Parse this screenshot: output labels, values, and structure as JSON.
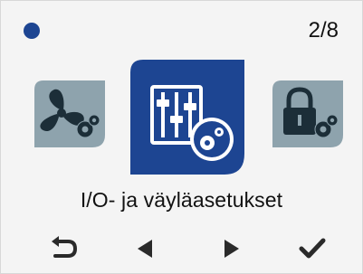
{
  "header": {
    "status_dot_color": "#1d4592",
    "page_indicator": "2/8"
  },
  "menu": {
    "items": [
      {
        "icon": "fan-settings-icon",
        "state": "inactive"
      },
      {
        "icon": "io-bus-settings-icon",
        "state": "selected"
      },
      {
        "icon": "lock-settings-icon",
        "state": "inactive"
      }
    ],
    "selected_label": "I/O- ja väyläasetukset"
  },
  "nav": {
    "buttons": [
      {
        "icon": "back-icon"
      },
      {
        "icon": "previous-icon"
      },
      {
        "icon": "next-icon"
      },
      {
        "icon": "confirm-icon"
      }
    ]
  },
  "colors": {
    "selected_tile": "#1d4592",
    "inactive_tile": "#8ea3ad",
    "background": "#f4f4f4",
    "text": "#111111"
  }
}
